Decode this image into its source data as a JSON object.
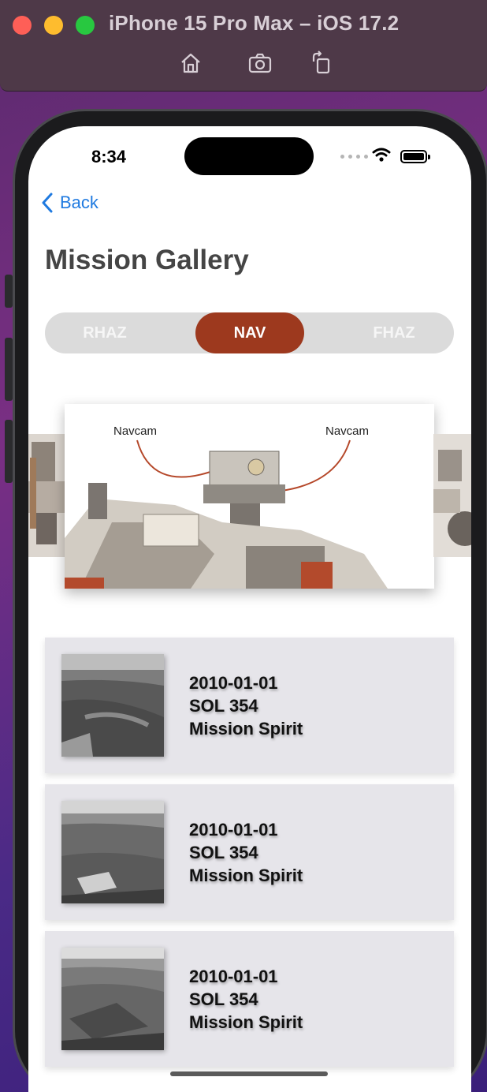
{
  "simulator": {
    "title": "iPhone 15 Pro Max – iOS 17.2",
    "toolbar": [
      "home-icon",
      "screenshot-icon",
      "rotate-icon"
    ]
  },
  "status_bar": {
    "time": "8:34"
  },
  "nav": {
    "back_label": "Back"
  },
  "page": {
    "title": "Mission Gallery"
  },
  "segments": [
    {
      "label": "RHAZ",
      "selected": false
    },
    {
      "label": "NAV",
      "selected": true
    },
    {
      "label": "FHAZ",
      "selected": false
    }
  ],
  "carousel": {
    "labels": [
      "Navcam",
      "Navcam"
    ]
  },
  "photos": [
    {
      "date": "2010-01-01",
      "sol": "SOL 354",
      "mission": "Mission Spirit"
    },
    {
      "date": "2010-01-01",
      "sol": "SOL 354",
      "mission": "Mission Spirit"
    },
    {
      "date": "2010-01-01",
      "sol": "SOL 354",
      "mission": "Mission Spirit"
    }
  ],
  "colors": {
    "accent": "#9d391e",
    "link": "#1f7ae0",
    "row_bg": "#e6e5ea",
    "segment_bg": "#dbdbdb"
  }
}
